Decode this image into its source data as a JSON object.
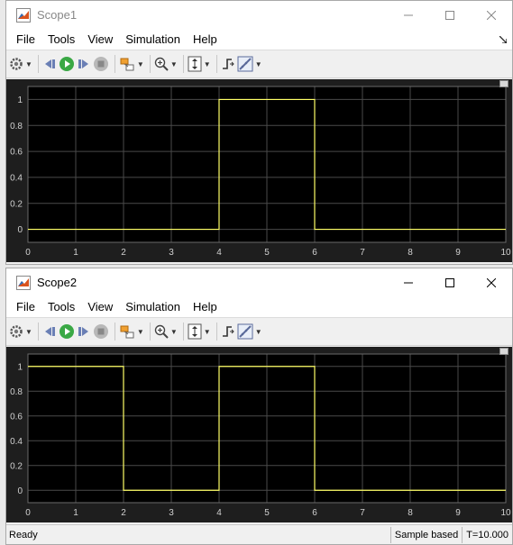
{
  "colors": {
    "plot_bg": "#000000",
    "axes_bg": "#1e1e1e",
    "grid": "#4a4a4a",
    "trace": "#ffff66",
    "tick_text": "#d0d0d0"
  },
  "windows": [
    {
      "title": "Scope1",
      "menu": [
        "File",
        "Tools",
        "View",
        "Simulation",
        "Help"
      ],
      "toolbar_icons": [
        "gear-icon",
        "step-back-icon",
        "run-icon",
        "step-forward-icon",
        "stop-icon",
        "highlight-icon",
        "zoom-in-icon",
        "autoscale-icon",
        "trigger-icon",
        "measure-icon"
      ],
      "status": null
    },
    {
      "title": "Scope2",
      "menu": [
        "File",
        "Tools",
        "View",
        "Simulation",
        "Help"
      ],
      "toolbar_icons": [
        "gear-icon",
        "step-back-icon",
        "run-icon",
        "step-forward-icon",
        "stop-icon",
        "highlight-icon",
        "zoom-in-icon",
        "autoscale-icon",
        "trigger-icon",
        "measure-icon"
      ],
      "status": {
        "ready": "Ready",
        "mode": "Sample based",
        "time": "T=10.000"
      }
    }
  ],
  "chart_data": [
    {
      "type": "line",
      "title": "",
      "xlabel": "",
      "ylabel": "",
      "xlim": [
        0,
        10
      ],
      "ylim": [
        -0.1,
        1.1
      ],
      "x_ticks": [
        "0",
        "1",
        "2",
        "3",
        "4",
        "5",
        "6",
        "7",
        "8",
        "9",
        "10"
      ],
      "y_ticks": [
        "0",
        "0.2",
        "0.4",
        "0.6",
        "0.8",
        "1"
      ],
      "grid": true,
      "series": [
        {
          "x": [
            0,
            4,
            4,
            6,
            6,
            10
          ],
          "y": [
            0,
            0,
            1,
            1,
            0,
            0
          ]
        }
      ]
    },
    {
      "type": "line",
      "title": "",
      "xlabel": "",
      "ylabel": "",
      "xlim": [
        0,
        10
      ],
      "ylim": [
        -0.1,
        1.1
      ],
      "x_ticks": [
        "0",
        "1",
        "2",
        "3",
        "4",
        "5",
        "6",
        "7",
        "8",
        "9",
        "10"
      ],
      "y_ticks": [
        "0",
        "0.2",
        "0.4",
        "0.6",
        "0.8",
        "1"
      ],
      "grid": true,
      "series": [
        {
          "x": [
            0,
            2,
            2,
            4,
            4,
            6,
            6,
            10
          ],
          "y": [
            1,
            1,
            0,
            0,
            1,
            1,
            0,
            0
          ]
        }
      ]
    }
  ]
}
